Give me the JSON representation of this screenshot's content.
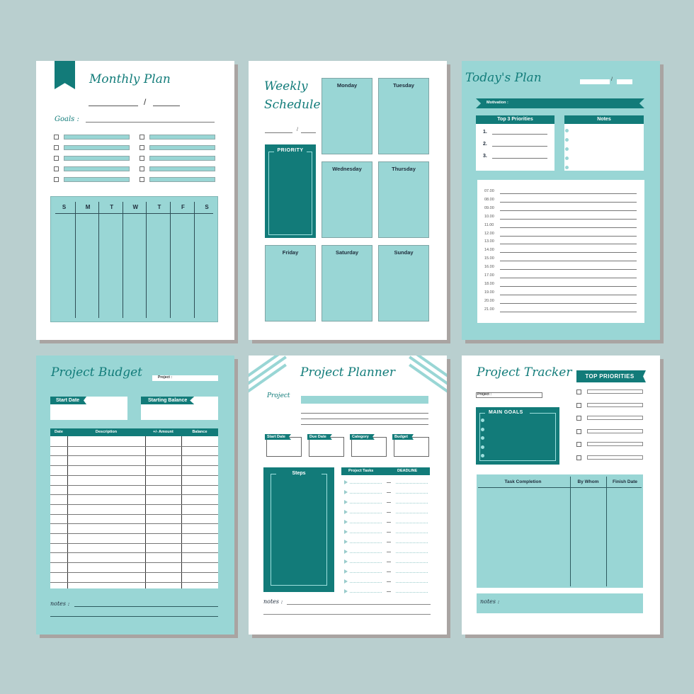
{
  "colors": {
    "background": "#b9cfcf",
    "teal": "#127b79",
    "aqua": "#99d6d5",
    "shadow": "#a9a4a2"
  },
  "monthly": {
    "title": "Monthly Plan",
    "date_separator": "/",
    "goals_label": "Goals :",
    "goal_count": 10,
    "weekdays": [
      "S",
      "M",
      "T",
      "W",
      "T",
      "F",
      "S"
    ]
  },
  "weekly": {
    "title_line1": "Weekly",
    "title_line2": "Schedule",
    "date_separator": "/",
    "priority_label": "PRIORITY",
    "days": [
      "Monday",
      "Tuesday",
      "Wednesday",
      "Thursday",
      "Friday",
      "Saturday",
      "Sunday"
    ]
  },
  "today": {
    "title": "Today's Plan",
    "date_separator": "/",
    "motivation_label": "Motivation :",
    "priorities_header": "Top 3 Priorities",
    "priorities": [
      "1.",
      "2.",
      "3."
    ],
    "notes_header": "Notes",
    "times": [
      "07.00",
      "08.00",
      "09.00",
      "10.00",
      "11.00",
      "12.00",
      "13.00",
      "14.00",
      "15.00",
      "16.00",
      "17.00",
      "18.00",
      "19.00",
      "20.00",
      "21.00"
    ]
  },
  "budget": {
    "title": "Project Budget",
    "project_label": "Project :",
    "start_date_label": "Start Date",
    "starting_balance_label": "Starting Balance",
    "columns": [
      "Date",
      "Description",
      "+/- Amount",
      "Balance"
    ],
    "notes_label": "notes :"
  },
  "planner": {
    "title": "Project Planner",
    "project_label": "Project",
    "fields": [
      "Start Date",
      "Due Date",
      "Category",
      "Budget"
    ],
    "steps_label": "Steps",
    "tasks_header": "Project Tasks",
    "deadline_header": "DEADLINE",
    "task_rows": 12,
    "notes_label": "notes :"
  },
  "tracker": {
    "title": "Project Tracker",
    "project_label": "Project :",
    "top_priorities_label": "TOP PRIORITIES",
    "priority_rows": 6,
    "main_goals_label": "MAIN GOALS",
    "columns": [
      "Task Completion",
      "By Whom",
      "Finish Date"
    ],
    "notes_label": "notes :"
  }
}
